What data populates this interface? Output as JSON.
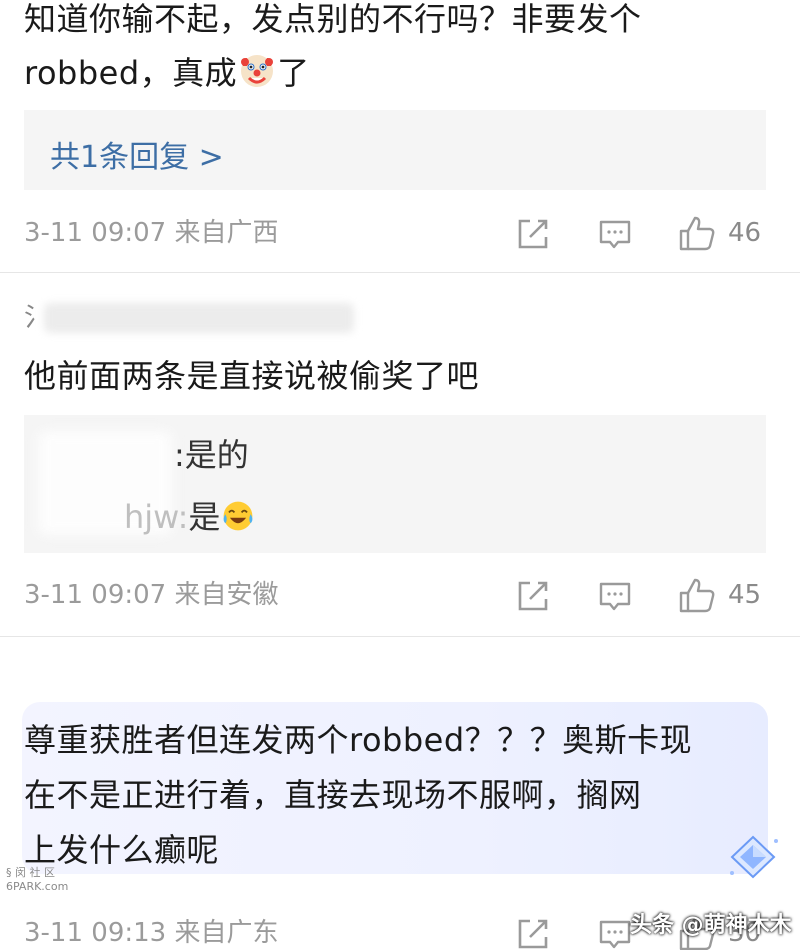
{
  "comments": [
    {
      "text_line1": "知道你输不起，发点别的不行吗？非要发个",
      "text_line2_prefix": "robbed，真成",
      "text_line2_suffix": "了",
      "emoji": "clown-face-icon",
      "reply_summary": "共1条回复 >",
      "time": "3-11 09:07 来自广西",
      "likes": "46"
    },
    {
      "username_partial": "氵",
      "text": "他前面两条是直接说被偷奖了吧",
      "replies": [
        {
          "author_partial": ":",
          "text": "是的"
        },
        {
          "author_partial": "hjw:",
          "text": "是",
          "emoji": "laughing-crying-icon"
        }
      ],
      "time": "3-11 09:07 来自安徽",
      "likes": "45"
    },
    {
      "text_line1": "尊重获胜者但连发两个robbed？？？奥斯卡现",
      "text_line2": "在不是正进行着，直接去现场不服啊，搁网",
      "text_line3": "上发什么癫呢",
      "time": "3-11 09:13 来自广东",
      "likes": "30"
    }
  ],
  "watermark": {
    "left_line1": "§ 闵 社 区",
    "left_line2": "6PARK.com",
    "right": "头条 @萌神木木"
  },
  "colors": {
    "link": "#3d6ea5",
    "meta": "#9b9b9b",
    "reply_bg": "#f5f5f5",
    "highlight_bg": "#eef1ff"
  }
}
